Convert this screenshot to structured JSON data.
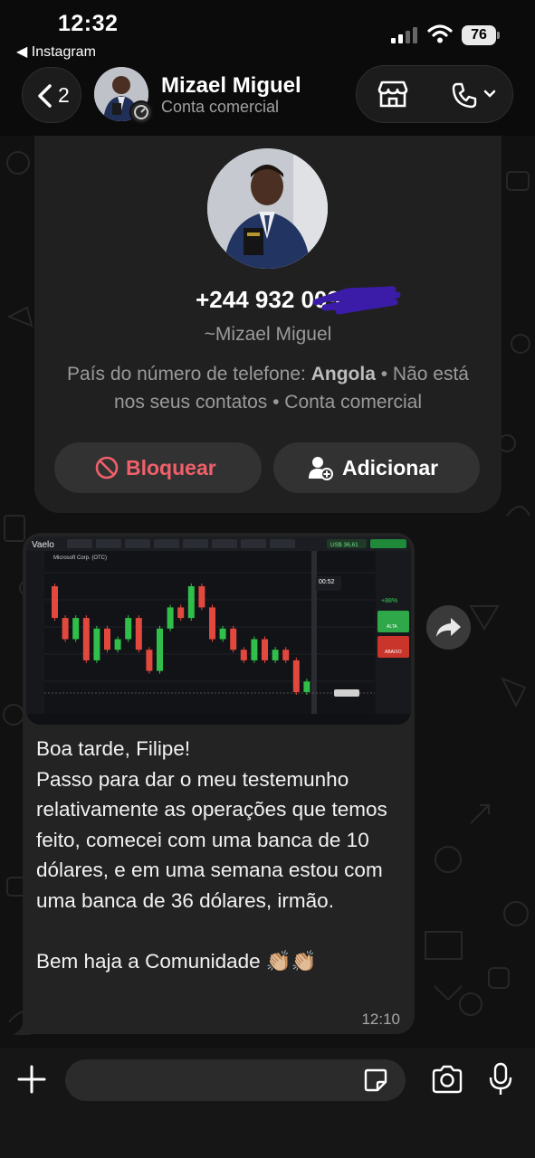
{
  "status_bar": {
    "time": "12:32",
    "back_app": "◀ Instagram",
    "battery": "76"
  },
  "header": {
    "back_count": "2",
    "contact_name": "Mizael Miguel",
    "contact_subtitle": "Conta comercial"
  },
  "contact_card": {
    "phone_number": "+244 932 009",
    "display_name": "~Mizael Miguel",
    "info_label": "País do número de telefone: ",
    "info_country": "Angola",
    "info_rest": " • Não está nos seus contatos • Conta comercial",
    "block_label": "Bloquear",
    "add_label": "Adicionar"
  },
  "message": {
    "text": "Boa tarde, Filipe!\nPasso para dar o meu testemunho relativamente as operações que temos feito, comecei com uma banca de 10 dólares, e em uma semana estou com uma banca de 36 dólares, irmão.\n\nBem haja a Comunidade 👏🏼👏🏼",
    "time": "12:10"
  },
  "embedded_screenshot": {
    "brand": "Vaelo",
    "asset": "Microsoft Corp. (OTC)",
    "balance": "US$ 36,61",
    "timer": "00:52",
    "payout": "+88%",
    "up_label": "ALTA",
    "down_label": "ABAIXO",
    "candle_changes": [
      -3,
      -2,
      2,
      -4,
      3,
      -2,
      1,
      2,
      -3,
      -2,
      4,
      2,
      -1,
      3,
      -2,
      -3,
      1,
      -2,
      -1,
      2,
      -2,
      1,
      -1,
      -3,
      1
    ]
  },
  "composer": {
    "placeholder": ""
  },
  "colors": {
    "background": "#111111",
    "bubble": "#232323",
    "block_red": "#f0606a",
    "candle_up": "#2fbf4a",
    "candle_down": "#e2483d"
  }
}
